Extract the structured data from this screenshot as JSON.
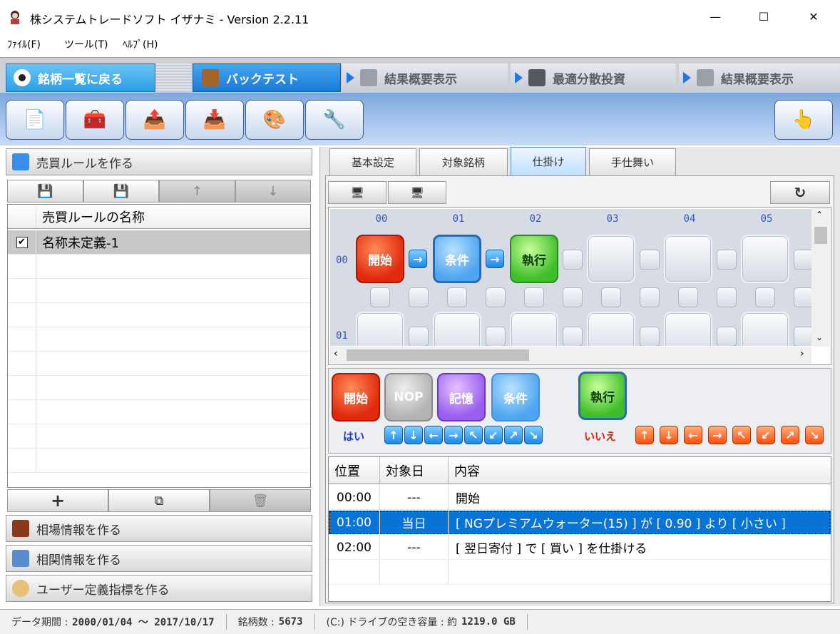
{
  "window": {
    "title": "株システムトレードソフト イザナミ - Version 2.2.11",
    "minimize": "—",
    "maximize": "☐",
    "close": "✕"
  },
  "menu": [
    "ﾌｧｲﾙ(F)",
    "ツール(T)",
    "ﾍﾙﾌﾟ(H)"
  ],
  "nav": {
    "back": "銘柄一覧に戻る",
    "backtest": "バックテスト",
    "summary1": "結果概要表示",
    "optimal": "最適分散投資",
    "summary2": "結果概要表示"
  },
  "left": {
    "make_rules": "売買ルールを作る",
    "rule_header": "売買ルールの名称",
    "rules": [
      {
        "name": "名称未定義-1",
        "checked": true
      }
    ],
    "market_info": "相場情報を作る",
    "correlation": "相関情報を作る",
    "user_indicator": "ユーザー定義指標を作る"
  },
  "tabs": [
    "基本設定",
    "対象銘柄",
    "仕掛け",
    "手仕舞い"
  ],
  "grid": {
    "columns": [
      "00",
      "01",
      "02",
      "03",
      "04",
      "05"
    ],
    "rows": [
      "00",
      "01"
    ],
    "nodes": {
      "start": "開始",
      "cond": "条件",
      "exec": "執行"
    }
  },
  "palette": {
    "start": "開始",
    "nop": "NOP",
    "memory": "記憶",
    "cond": "条件",
    "exec": "執行",
    "yes": "はい",
    "no": "いいえ",
    "arrows": [
      "↑",
      "↓",
      "←",
      "→",
      "↖",
      "↙",
      "↗",
      "↘"
    ]
  },
  "steps": {
    "headers": [
      "位置",
      "対象日",
      "内容"
    ],
    "rows": [
      {
        "pos": "00:00",
        "day": "---",
        "content": "開始"
      },
      {
        "pos": "01:00",
        "day": "当日",
        "content": "[ NGプレミアムウォーター(15) ] が [ 0.90 ] より [ 小さい ]"
      },
      {
        "pos": "02:00",
        "day": "---",
        "content": "[ 翌日寄付 ] で [ 買い ] を仕掛ける"
      }
    ]
  },
  "status": {
    "period_label": "データ期間 :",
    "period_value": "2000/01/04 ～ 2017/10/17",
    "count_label": "銘柄数 :",
    "count_value": "5673",
    "drive_label": "(C:) ドライブの空き容量 : 約",
    "drive_value": "1219.0 GB"
  },
  "colors": {
    "accent": "#1a7ad8",
    "selection": "#0a73d6"
  }
}
